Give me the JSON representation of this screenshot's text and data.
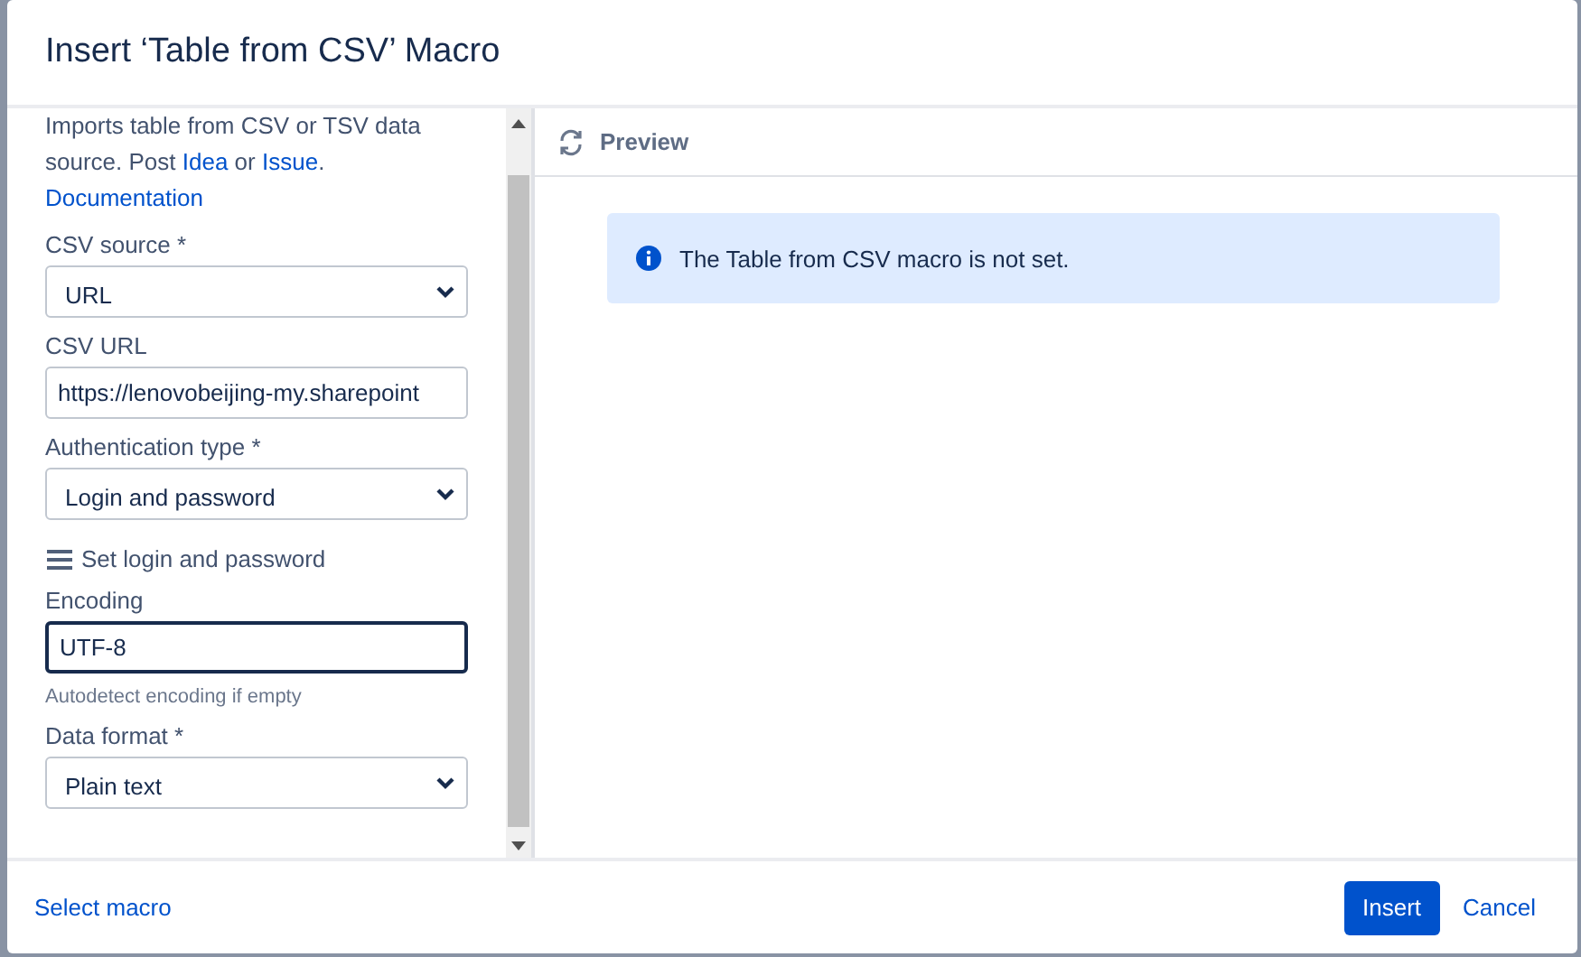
{
  "dialog": {
    "title": "Insert ‘Table from CSV’ Macro"
  },
  "intro": {
    "text_before": "Imports table from CSV or TSV data source. Post",
    "link_1": "Idea",
    "text_middle": "or",
    "link_2": "Issue",
    "text_after": ".",
    "doc_link": "Documentation"
  },
  "fields": [
    {
      "kind": "select",
      "label": "CSV source *",
      "value": "URL"
    },
    {
      "kind": "text",
      "label": "CSV URL",
      "value": "https://lenovobeijing-my.sharepoint",
      "focused": false
    },
    {
      "kind": "select",
      "label": "Authentication type *",
      "value": "Login and password"
    },
    {
      "kind": "action",
      "label": "Set login and password"
    },
    {
      "kind": "text",
      "label": "Encoding",
      "value": "UTF-8",
      "focused": true,
      "hint": "Autodetect encoding if empty"
    },
    {
      "kind": "select",
      "label": "Data format *",
      "value": "Plain text"
    }
  ],
  "preview": {
    "title": "Preview",
    "message": "The Table from CSV macro is not set."
  },
  "footer": {
    "left_link": "Select macro",
    "primary_button": "Insert",
    "cancel_link": "Cancel"
  }
}
